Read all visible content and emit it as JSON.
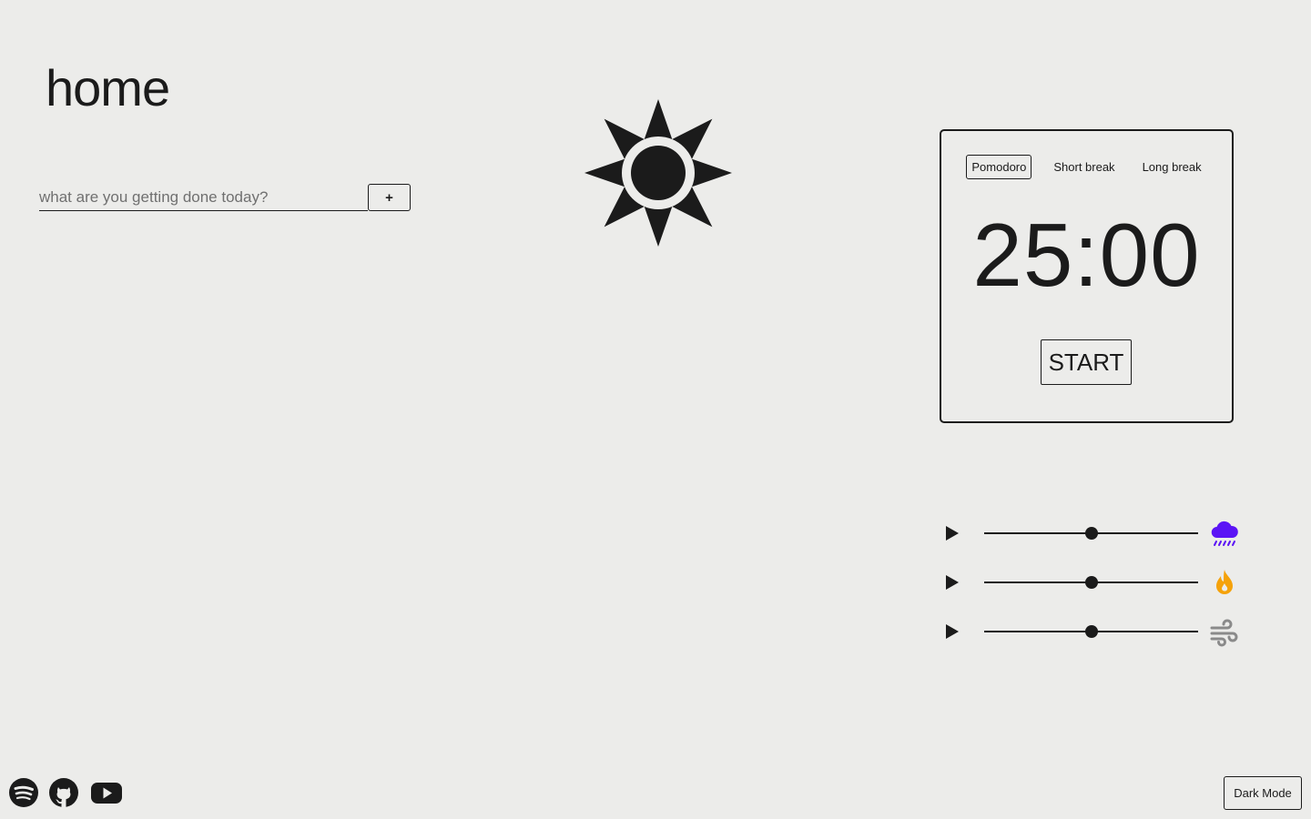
{
  "page": {
    "title": "home"
  },
  "todo": {
    "placeholder": "what are you getting done today?",
    "add_label": "+"
  },
  "theme_icon": "sun-icon",
  "timer": {
    "modes": [
      {
        "label": "Pomodoro",
        "active": true
      },
      {
        "label": "Short break",
        "active": false
      },
      {
        "label": "Long break",
        "active": false
      }
    ],
    "time": "25:00",
    "start_label": "START"
  },
  "sounds": [
    {
      "name": "rain",
      "icon": "rain-cloud-icon",
      "volume": 0.5,
      "color": "#5b14f5"
    },
    {
      "name": "fire",
      "icon": "flame-icon",
      "volume": 0.5,
      "color": "#f5a20a"
    },
    {
      "name": "wind",
      "icon": "wind-icon",
      "volume": 0.5,
      "color": "#8a8a8a"
    }
  ],
  "social_links": [
    "spotify-icon",
    "github-icon",
    "youtube-icon"
  ],
  "dark_mode_label": "Dark Mode",
  "colors": {
    "background": "#ececea",
    "foreground": "#1b1b1b"
  }
}
